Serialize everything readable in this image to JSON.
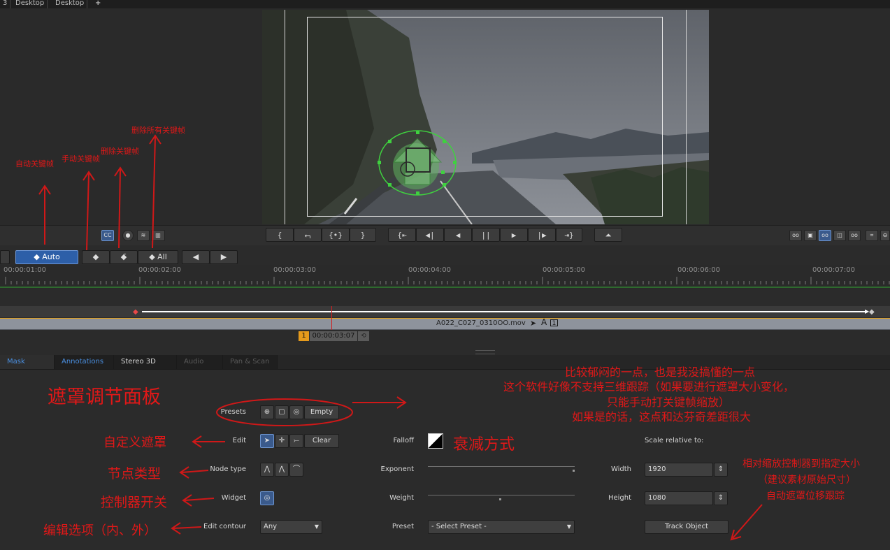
{
  "top_tabs": [
    "3",
    "Desktop",
    "Desktop",
    "+"
  ],
  "transport": {
    "buttons": [
      "{",
      "⮢",
      "{•}",
      "}",
      "{⇤",
      "◀|",
      "◀",
      "||",
      "▶",
      "|▶",
      "⇥}",
      "⏶"
    ]
  },
  "keyframe_row": {
    "auto": "◆ Auto",
    "add": "◆",
    "delete": "◆̄",
    "delete_all": "◆ All",
    "prev": "◀",
    "next": "▶"
  },
  "ruler": {
    "timecodes": [
      "00:00:01:00",
      "00:00:02:00",
      "00:00:03:00",
      "00:00:04:00",
      "00:00:05:00",
      "00:00:06:00",
      "00:00:07:00"
    ]
  },
  "timeline": {
    "clip_name": "A022_C027_0310OO.mov",
    "clip_track": "A",
    "clip_track_num": "1",
    "playhead_index": "1",
    "playhead_timecode": "00:00:03:07"
  },
  "panel_tabs": [
    "Mask",
    "Annotations",
    "Stereo 3D",
    "Audio",
    "Pan & Scan"
  ],
  "mask": {
    "presets_label": "Presets",
    "presets_empty": "Empty",
    "edit_label": "Edit",
    "edit_clear": "Clear",
    "node_type_label": "Node type",
    "widget_label": "Widget",
    "edit_contour_label": "Edit contour",
    "edit_contour_value": "Any",
    "falloff_label": "Falloff",
    "exponent_label": "Exponent",
    "exponent_value": 1.0,
    "weight_label": "Weight",
    "weight_value": 0.5,
    "preset_label": "Preset",
    "preset_value": "- Select Preset -",
    "scale_label": "Scale relative to:",
    "width_label": "Width",
    "width_value": "1920",
    "height_label": "Height",
    "height_value": "1080",
    "track_button": "Track Object"
  },
  "annotations": {
    "auto_kf": "自动关键帧",
    "manual_kf": "手动关键帧",
    "delete_kf": "删除关键帧",
    "delete_all_kf": "删除所有关键帧",
    "panel_title": "遮罩调节面板",
    "note_line1": "比较郁闷的一点，也是我没搞懂的一点",
    "note_line2": "这个软件好像不支持三维跟踪（如果要进行遮罩大小变化，",
    "note_line3": "只能手动打关键帧缩放）",
    "note_line4": "如果是的话，这点和达芬奇差距很大",
    "custom_mask": "自定义遮罩",
    "falloff_mode": "衰减方式",
    "node_type": "节点类型",
    "widget_toggle": "控制器开关",
    "edit_options": "编辑选项（内、外）",
    "scale_note1": "相对缩放控制器到指定大小",
    "scale_note2": "（建议素材原始尺寸）",
    "scale_note3": "自动遮罩位移跟踪"
  },
  "colors": {
    "annotation": "#e01818",
    "accent_blue": "#2d5fa8",
    "mask_green": "#3fd13f",
    "clip_bar": "#8e939c"
  }
}
